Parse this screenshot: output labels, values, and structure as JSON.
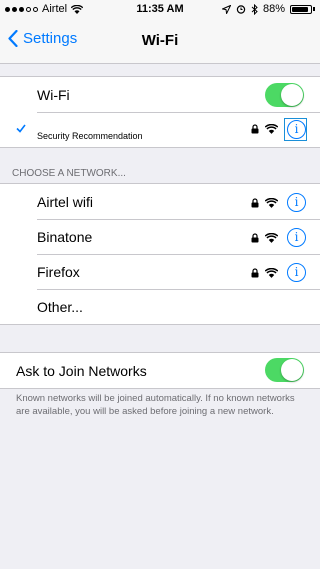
{
  "status_bar": {
    "carrier": "Airtel",
    "time": "11:35 AM",
    "battery_percent": "88%",
    "battery_level": 0.88
  },
  "nav": {
    "back_label": "Settings",
    "title": "Wi-Fi"
  },
  "wifi_group": {
    "wifi_label": "Wi-Fi",
    "wifi_on": true,
    "connected_subtitle": "Security Recommendation"
  },
  "networks_section": {
    "header": "CHOOSE A NETWORK...",
    "networks": [
      {
        "name": "Airtel wifi"
      },
      {
        "name": "Binatone"
      },
      {
        "name": "Firefox"
      }
    ],
    "other_label": "Other..."
  },
  "ask_group": {
    "label": "Ask to Join Networks",
    "on": true,
    "footer": "Known networks will be joined automatically. If no known networks are available, you will be asked before joining a new network."
  },
  "colors": {
    "accent": "#007aff",
    "switch_on": "#4cd964",
    "background": "#efeff4"
  },
  "icons": [
    "signal-dots-icon",
    "wifi-icon",
    "location-icon",
    "alarm-icon",
    "bluetooth-icon",
    "battery-icon",
    "chevron-left-icon",
    "checkmark-icon",
    "lock-icon",
    "info-icon"
  ]
}
